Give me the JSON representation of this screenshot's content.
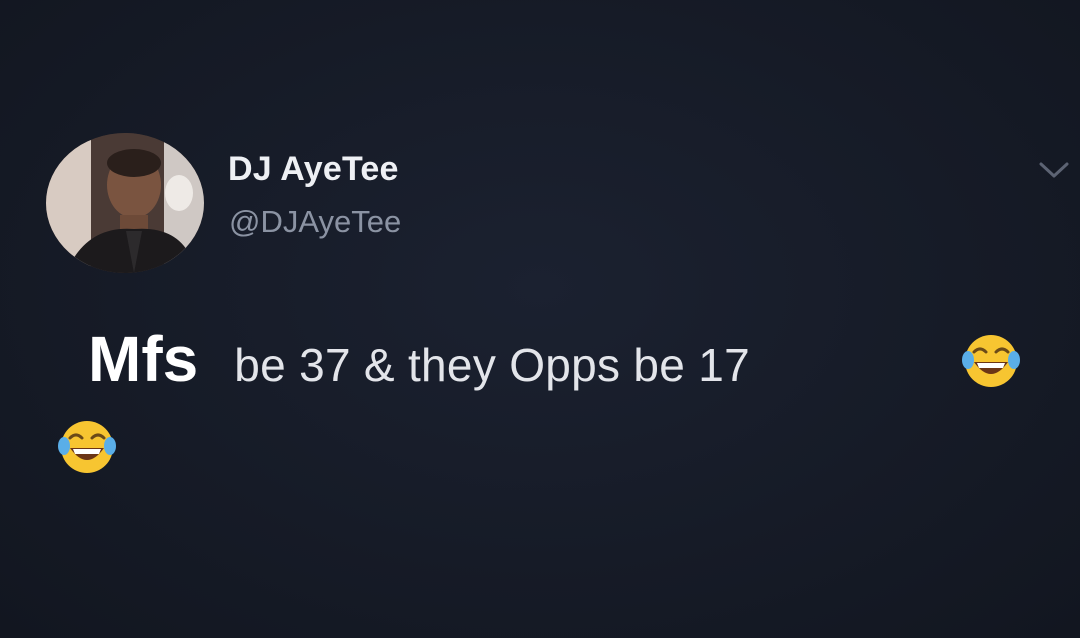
{
  "tweet": {
    "display_name": "DJ AyeTee",
    "handle": "@DJAyeTee",
    "text_emphasis": "Mfs",
    "text_rest": "be 37 & they Opps be 17",
    "emoji": [
      "face-with-tears-of-joy",
      "face-with-tears-of-joy"
    ]
  },
  "icons": {
    "menu": "chevron-down-icon"
  },
  "colors": {
    "background": "#151a26",
    "name": "#eef0f4",
    "handle": "#8b93a3",
    "emoji_face": "#f7c531"
  }
}
